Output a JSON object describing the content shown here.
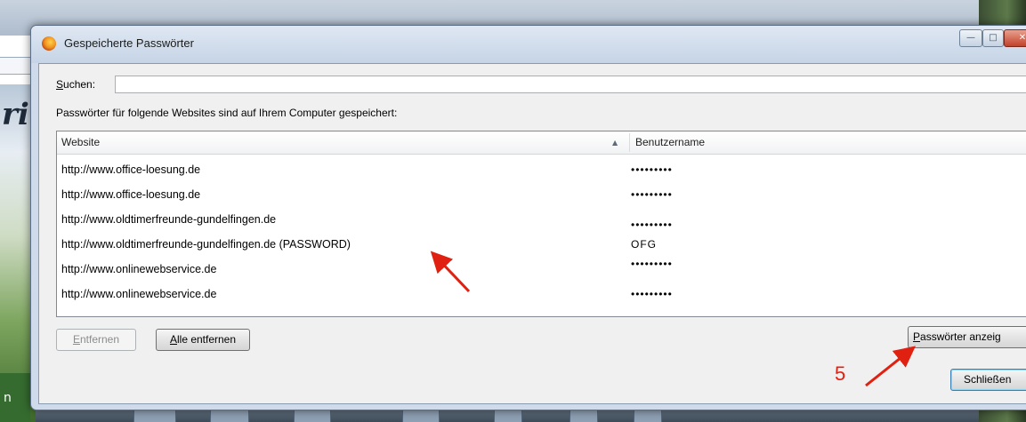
{
  "window": {
    "title": "Gespeicherte Passwörter",
    "controls": [
      "minimize-icon",
      "maximize-icon",
      "close-icon"
    ]
  },
  "search": {
    "label": "Suchen:",
    "value": "",
    "placeholder": ""
  },
  "description": "Passwörter für folgende Websites sind auf Ihrem Computer gespeichert:",
  "table": {
    "columns": [
      "Website",
      "Benutzername"
    ],
    "sort_indicator": "sort-ascending-icon",
    "rows": [
      {
        "website": "http://www.office-loesung.de",
        "username": "•••••••••"
      },
      {
        "website": "http://www.office-loesung.de",
        "username": "•••••••••"
      },
      {
        "website": "http://www.oldtimerfreunde-gundelfingen.de",
        "username": "•••••••••"
      },
      {
        "website": "http://www.oldtimerfreunde-gundelfingen.de (PASSWORD)",
        "username": "OFG"
      },
      {
        "website": "http://www.onlinewebservice.de",
        "username": "•••••••••"
      },
      {
        "website": "http://www.onlinewebservice.de",
        "username": "•••••••••"
      }
    ]
  },
  "buttons": {
    "remove": "Entfernen",
    "remove_all": "Alle entfernen",
    "show_passwords": "Passwörter anzeig",
    "close": "Schließen"
  },
  "annotations": {
    "step_number": "5",
    "arrow_color": "#e02010"
  },
  "background": {
    "script_text": "ri",
    "side_label": "n"
  },
  "colors": {
    "titlebar": "#cfdbea",
    "client": "#f0f0f0",
    "annotation": "#e02010"
  }
}
